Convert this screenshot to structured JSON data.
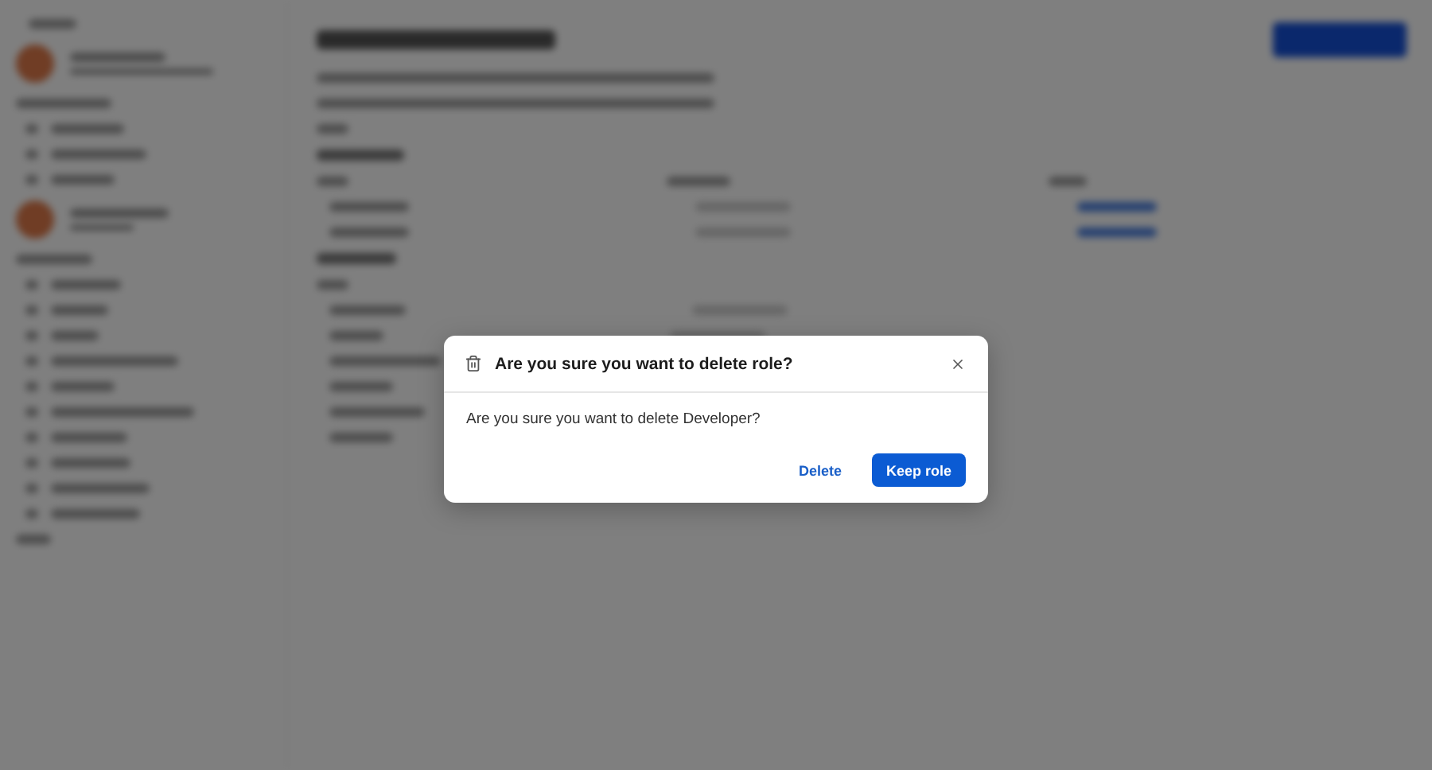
{
  "dialog": {
    "title": "Are you sure you want to delete role?",
    "message": "Are you sure you want to delete Developer?",
    "buttons": [
      {
        "label": "Delete",
        "kind": "text"
      },
      {
        "label": "Keep role",
        "kind": "primary"
      }
    ]
  }
}
